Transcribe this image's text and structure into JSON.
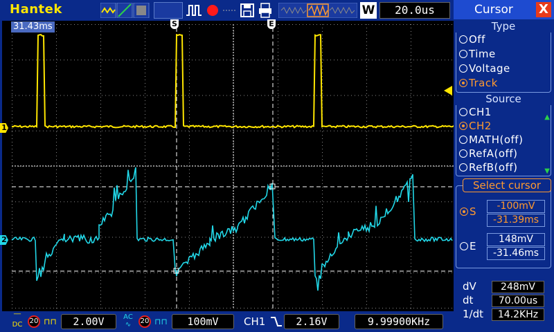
{
  "colors": {
    "ch1": "#ffe600",
    "ch2": "#22d8e8",
    "panel_bg": "#0a2a8a",
    "selected": "#ff9a30"
  },
  "topbar": {
    "brand": "Hantek",
    "timebase": "20.0us",
    "trigger_mode_label": "W",
    "icons": [
      "waveform-mode-icon",
      "pulse-icon",
      "record-dot-icon",
      "save-icon",
      "print-icon",
      "memory-depth-icon"
    ]
  },
  "screen": {
    "time_offset": "31.43ms",
    "marker_s": "S",
    "marker_e": "E",
    "ch1_marker": "1",
    "ch2_marker": "2"
  },
  "bottombar": {
    "ch1_coupling": "DC",
    "ch1_bw": "20",
    "ch1_volts": "2.00V",
    "ch2_coupling": "AC",
    "ch2_bw": "20",
    "ch2_volts": "100mV",
    "trigger_source": "CH1",
    "trigger_level": "2.16V",
    "frequency": "9.99900KHz"
  },
  "panel": {
    "title": "Cursor",
    "close": "X",
    "type_group": {
      "title": "Type",
      "options": [
        "Off",
        "Time",
        "Voltage",
        "Track"
      ],
      "selected": "Track"
    },
    "source_group": {
      "title": "Source",
      "options": [
        "CH1",
        "CH2",
        "MATH(off)",
        "RefA(off)",
        "RefB(off)"
      ],
      "selected": "CH2"
    },
    "select_cursor": {
      "title": "Select cursor",
      "s_label": "S",
      "s_voltage": "-100mV",
      "s_time": "-31.39ms",
      "e_label": "E",
      "e_voltage": "148mV",
      "e_time": "-31.46ms"
    },
    "measurements": {
      "dv_label": "dV",
      "dv": "248mV",
      "dt_label": "dt",
      "dt": "70.00us",
      "inv_dt_label": "1/dt",
      "inv_dt": "14.2KHz"
    }
  }
}
